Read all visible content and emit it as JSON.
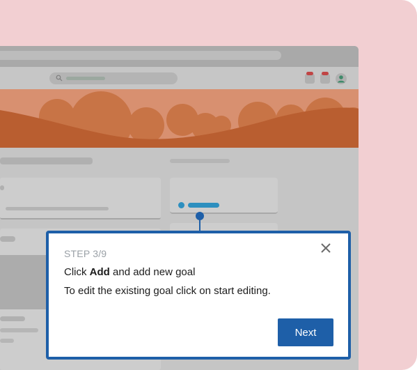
{
  "tooltip": {
    "step": "STEP 3/9",
    "line1_prefix": "Click ",
    "line1_bold": "Add",
    "line1_suffix": " and add new goal",
    "line2": "To edit the existing goal click on start editing.",
    "next_label": "Next",
    "close_icon": "close-icon"
  },
  "colors": {
    "accent": "#1e5fa8",
    "background": "#f2cfd2",
    "banner": "#c86a40"
  }
}
